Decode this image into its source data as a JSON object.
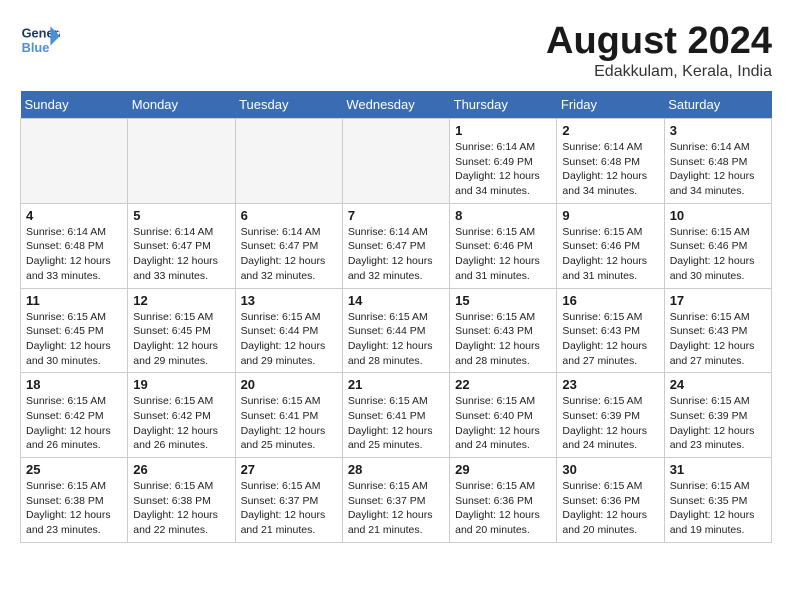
{
  "header": {
    "logo_line1": "General",
    "logo_line2": "Blue",
    "month": "August 2024",
    "location": "Edakkulam, Kerala, India"
  },
  "days_of_week": [
    "Sunday",
    "Monday",
    "Tuesday",
    "Wednesday",
    "Thursday",
    "Friday",
    "Saturday"
  ],
  "weeks": [
    [
      {
        "day": "",
        "info": ""
      },
      {
        "day": "",
        "info": ""
      },
      {
        "day": "",
        "info": ""
      },
      {
        "day": "",
        "info": ""
      },
      {
        "day": "1",
        "info": "Sunrise: 6:14 AM\nSunset: 6:49 PM\nDaylight: 12 hours\nand 34 minutes."
      },
      {
        "day": "2",
        "info": "Sunrise: 6:14 AM\nSunset: 6:48 PM\nDaylight: 12 hours\nand 34 minutes."
      },
      {
        "day": "3",
        "info": "Sunrise: 6:14 AM\nSunset: 6:48 PM\nDaylight: 12 hours\nand 34 minutes."
      }
    ],
    [
      {
        "day": "4",
        "info": "Sunrise: 6:14 AM\nSunset: 6:48 PM\nDaylight: 12 hours\nand 33 minutes."
      },
      {
        "day": "5",
        "info": "Sunrise: 6:14 AM\nSunset: 6:47 PM\nDaylight: 12 hours\nand 33 minutes."
      },
      {
        "day": "6",
        "info": "Sunrise: 6:14 AM\nSunset: 6:47 PM\nDaylight: 12 hours\nand 32 minutes."
      },
      {
        "day": "7",
        "info": "Sunrise: 6:14 AM\nSunset: 6:47 PM\nDaylight: 12 hours\nand 32 minutes."
      },
      {
        "day": "8",
        "info": "Sunrise: 6:15 AM\nSunset: 6:46 PM\nDaylight: 12 hours\nand 31 minutes."
      },
      {
        "day": "9",
        "info": "Sunrise: 6:15 AM\nSunset: 6:46 PM\nDaylight: 12 hours\nand 31 minutes."
      },
      {
        "day": "10",
        "info": "Sunrise: 6:15 AM\nSunset: 6:46 PM\nDaylight: 12 hours\nand 30 minutes."
      }
    ],
    [
      {
        "day": "11",
        "info": "Sunrise: 6:15 AM\nSunset: 6:45 PM\nDaylight: 12 hours\nand 30 minutes."
      },
      {
        "day": "12",
        "info": "Sunrise: 6:15 AM\nSunset: 6:45 PM\nDaylight: 12 hours\nand 29 minutes."
      },
      {
        "day": "13",
        "info": "Sunrise: 6:15 AM\nSunset: 6:44 PM\nDaylight: 12 hours\nand 29 minutes."
      },
      {
        "day": "14",
        "info": "Sunrise: 6:15 AM\nSunset: 6:44 PM\nDaylight: 12 hours\nand 28 minutes."
      },
      {
        "day": "15",
        "info": "Sunrise: 6:15 AM\nSunset: 6:43 PM\nDaylight: 12 hours\nand 28 minutes."
      },
      {
        "day": "16",
        "info": "Sunrise: 6:15 AM\nSunset: 6:43 PM\nDaylight: 12 hours\nand 27 minutes."
      },
      {
        "day": "17",
        "info": "Sunrise: 6:15 AM\nSunset: 6:43 PM\nDaylight: 12 hours\nand 27 minutes."
      }
    ],
    [
      {
        "day": "18",
        "info": "Sunrise: 6:15 AM\nSunset: 6:42 PM\nDaylight: 12 hours\nand 26 minutes."
      },
      {
        "day": "19",
        "info": "Sunrise: 6:15 AM\nSunset: 6:42 PM\nDaylight: 12 hours\nand 26 minutes."
      },
      {
        "day": "20",
        "info": "Sunrise: 6:15 AM\nSunset: 6:41 PM\nDaylight: 12 hours\nand 25 minutes."
      },
      {
        "day": "21",
        "info": "Sunrise: 6:15 AM\nSunset: 6:41 PM\nDaylight: 12 hours\nand 25 minutes."
      },
      {
        "day": "22",
        "info": "Sunrise: 6:15 AM\nSunset: 6:40 PM\nDaylight: 12 hours\nand 24 minutes."
      },
      {
        "day": "23",
        "info": "Sunrise: 6:15 AM\nSunset: 6:39 PM\nDaylight: 12 hours\nand 24 minutes."
      },
      {
        "day": "24",
        "info": "Sunrise: 6:15 AM\nSunset: 6:39 PM\nDaylight: 12 hours\nand 23 minutes."
      }
    ],
    [
      {
        "day": "25",
        "info": "Sunrise: 6:15 AM\nSunset: 6:38 PM\nDaylight: 12 hours\nand 23 minutes."
      },
      {
        "day": "26",
        "info": "Sunrise: 6:15 AM\nSunset: 6:38 PM\nDaylight: 12 hours\nand 22 minutes."
      },
      {
        "day": "27",
        "info": "Sunrise: 6:15 AM\nSunset: 6:37 PM\nDaylight: 12 hours\nand 21 minutes."
      },
      {
        "day": "28",
        "info": "Sunrise: 6:15 AM\nSunset: 6:37 PM\nDaylight: 12 hours\nand 21 minutes."
      },
      {
        "day": "29",
        "info": "Sunrise: 6:15 AM\nSunset: 6:36 PM\nDaylight: 12 hours\nand 20 minutes."
      },
      {
        "day": "30",
        "info": "Sunrise: 6:15 AM\nSunset: 6:36 PM\nDaylight: 12 hours\nand 20 minutes."
      },
      {
        "day": "31",
        "info": "Sunrise: 6:15 AM\nSunset: 6:35 PM\nDaylight: 12 hours\nand 19 minutes."
      }
    ]
  ]
}
